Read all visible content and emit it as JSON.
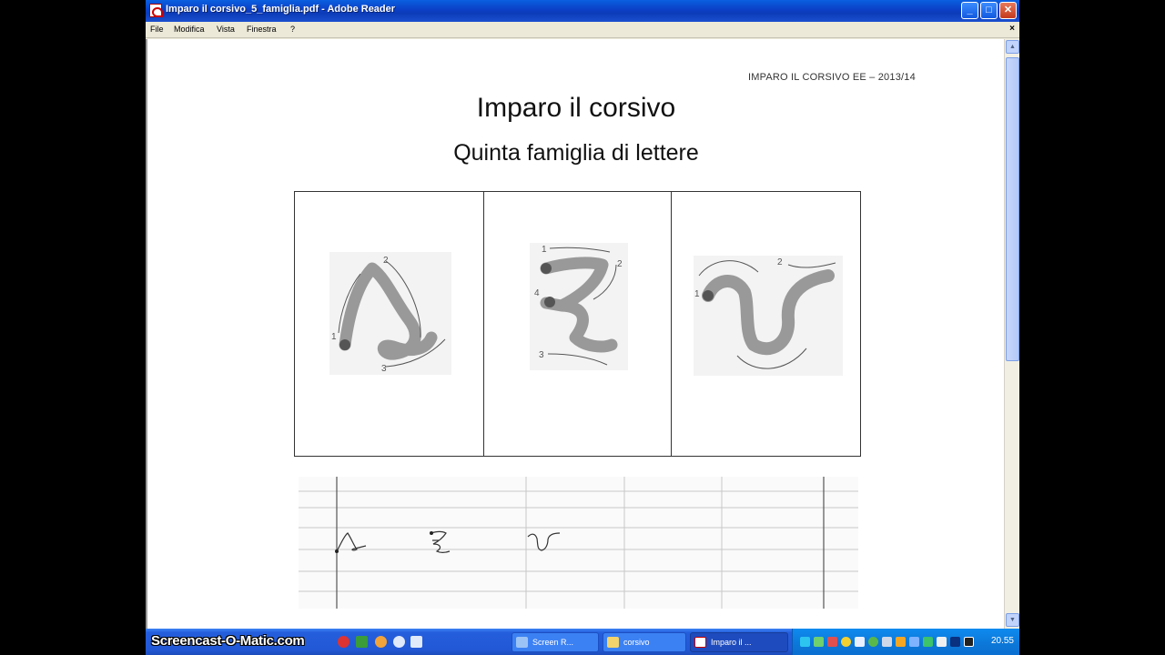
{
  "window": {
    "title": "Imparo il corsivo_5_famiglia.pdf - Adobe Reader",
    "controls": {
      "minimize": "_",
      "maximize": "□",
      "close": "✕"
    }
  },
  "menu": {
    "items": [
      "File",
      "Modifica",
      "Vista",
      "Finestra",
      "?"
    ],
    "doc_close": "×"
  },
  "document": {
    "header": "IMPARO IL CORSIVO    EE – 2013/14",
    "title": "Imparo il corsivo",
    "subtitle": "Quinta famiglia di lettere",
    "letters": [
      {
        "name": "s",
        "stroke_numbers": [
          "1",
          "2",
          "3"
        ]
      },
      {
        "name": "z",
        "stroke_numbers": [
          "1",
          "2",
          "3",
          "4"
        ]
      },
      {
        "name": "v",
        "stroke_numbers": [
          "1",
          "2"
        ]
      }
    ]
  },
  "taskbar": {
    "watermark": "Screencast-O-Matic.com",
    "buttons": [
      {
        "label": "Screen R...",
        "active": false
      },
      {
        "label": "corsivo",
        "active": false
      },
      {
        "label": "Imparo il ...",
        "active": true
      }
    ],
    "clock": "20.55"
  },
  "colors": {
    "titlebar": "#0b3fc6",
    "taskbar": "#245edc",
    "tray": "#0c77d8",
    "letter_stroke": "#999999",
    "letter_dot": "#555555"
  }
}
